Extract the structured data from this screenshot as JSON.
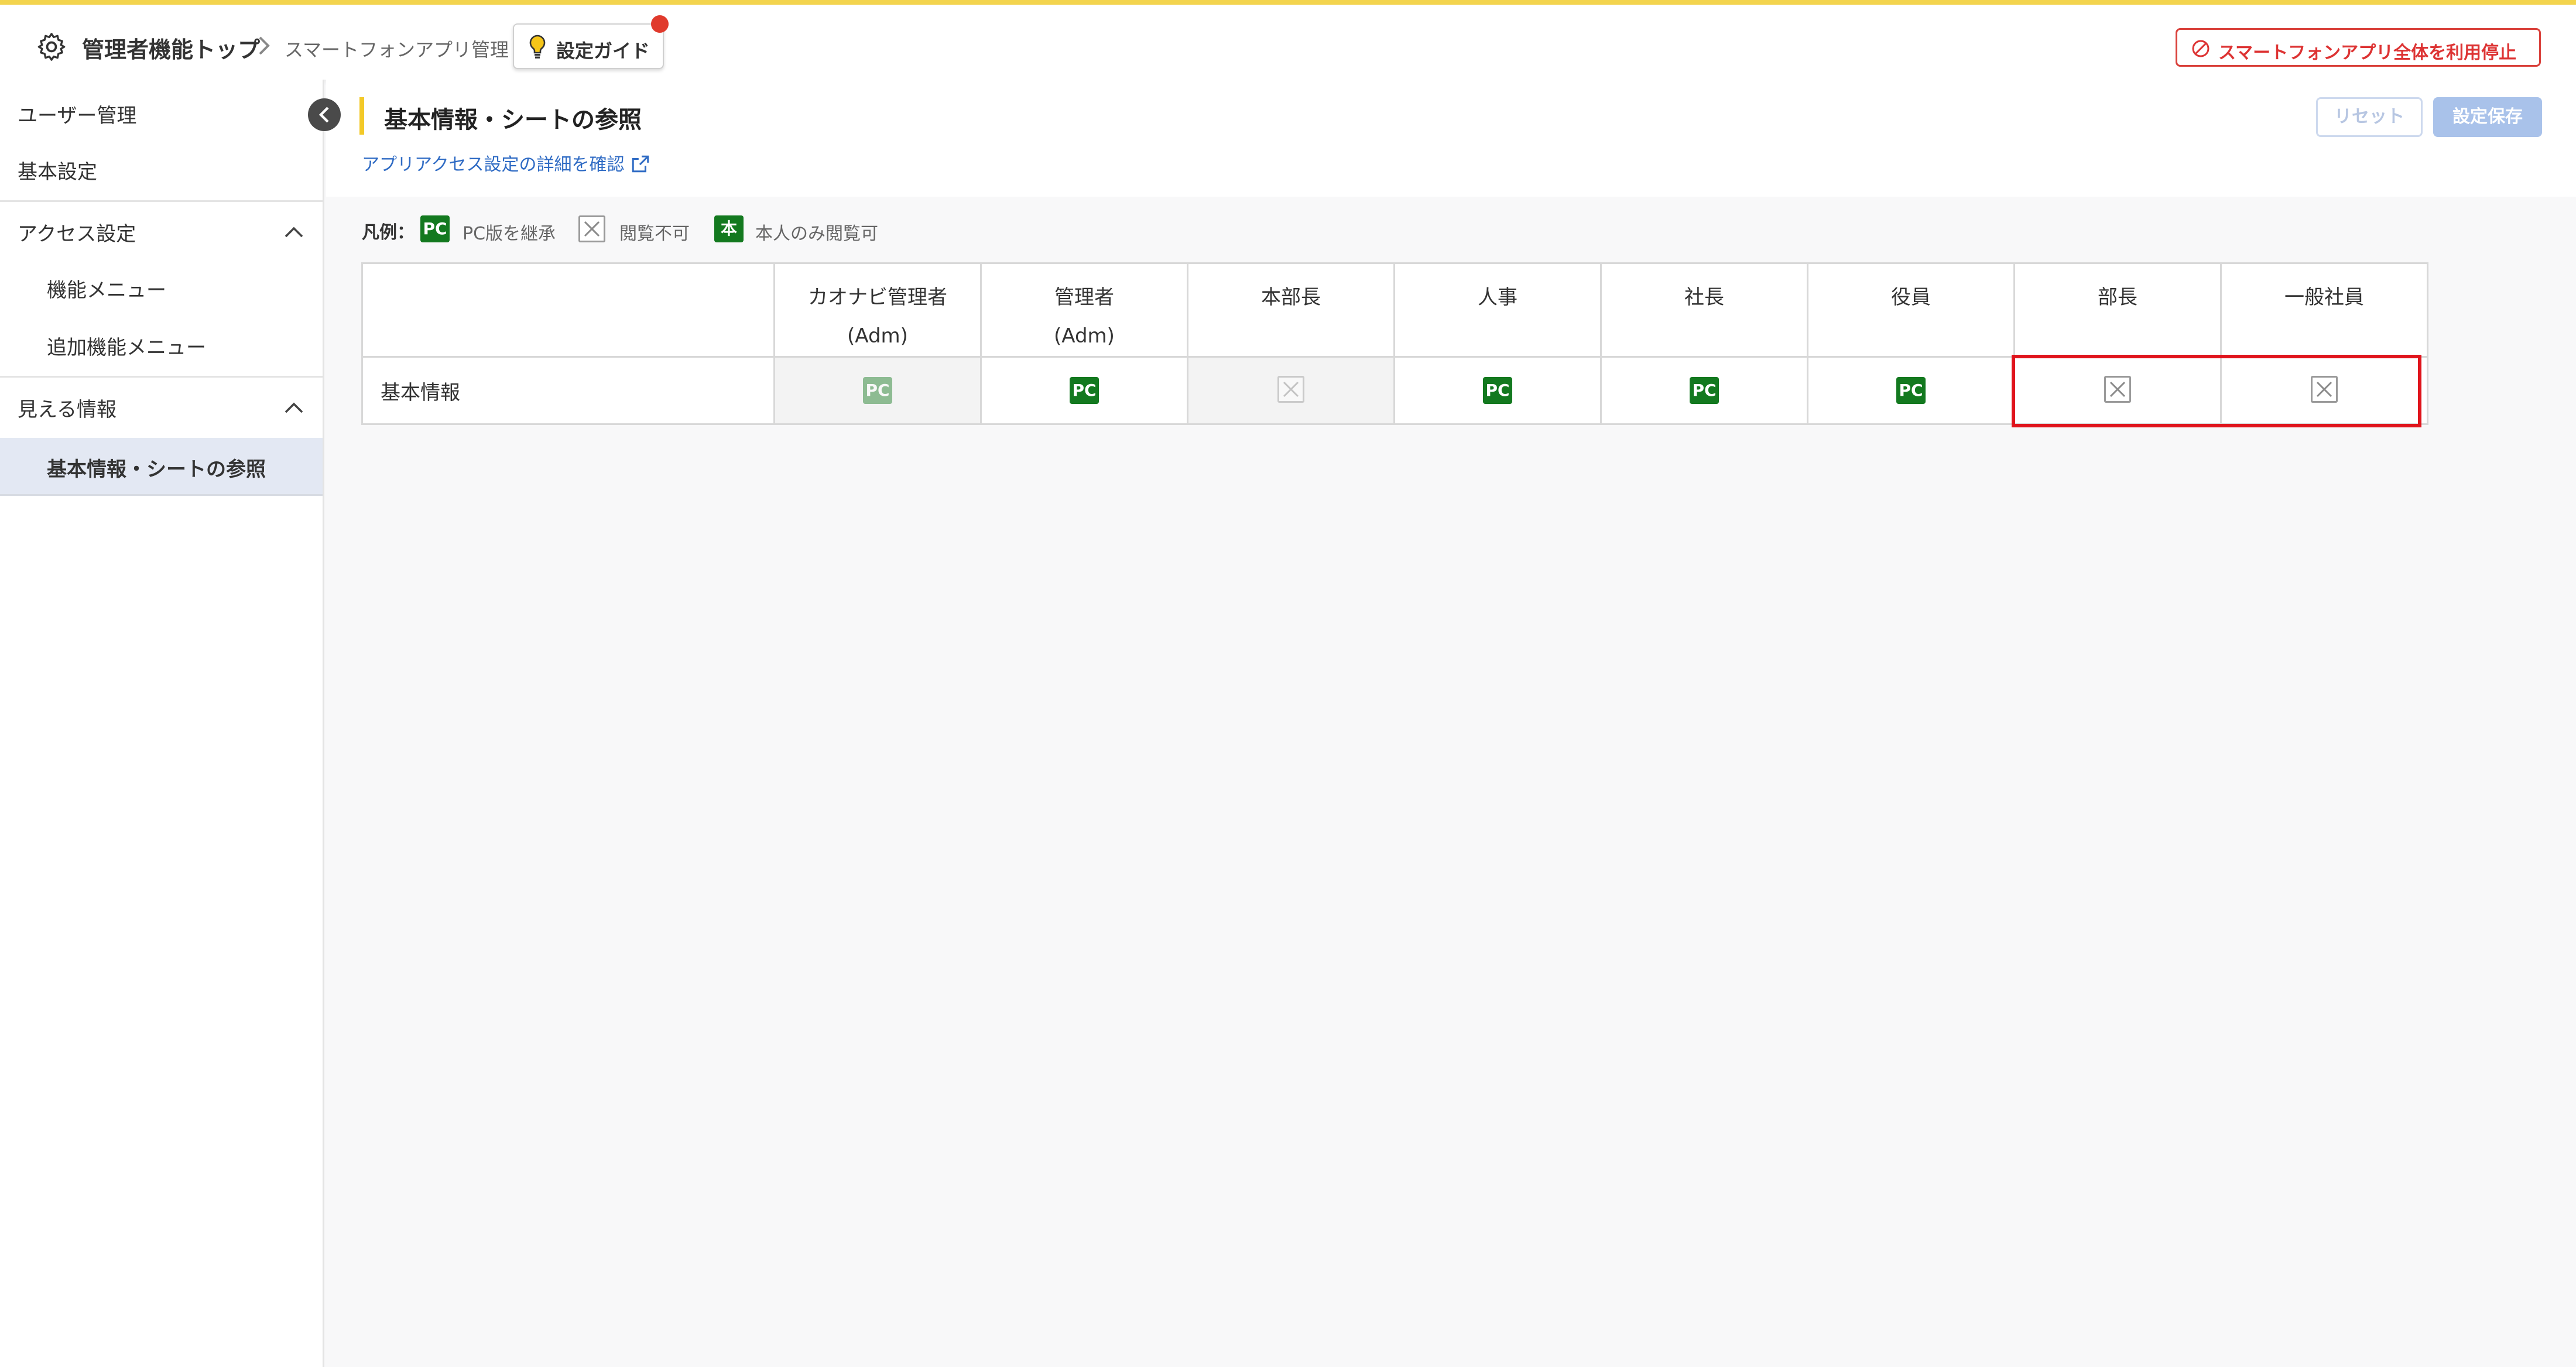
{
  "header": {
    "breadcrumb_home": "管理者機能トップ",
    "breadcrumb_current": "スマートフォンアプリ管理",
    "guide_button": "設定ガイド",
    "stop_button": "スマートフォンアプリ全体を利用停止"
  },
  "sidebar": {
    "user_mgmt": "ユーザー管理",
    "basic_settings": "基本設定",
    "access_settings": "アクセス設定",
    "function_menu": "機能メニュー",
    "additional_menu": "追加機能メニュー",
    "visible_info": "見える情報",
    "basic_info_sheet": "基本情報・シートの参照"
  },
  "main": {
    "title": "基本情報・シートの参照",
    "detail_link": "アプリアクセス設定の詳細を確認",
    "reset_button": "リセット",
    "save_button": "設定保存"
  },
  "legend": {
    "label": "凡例：",
    "pc_badge": "PC",
    "pc_text": "PC版を継承",
    "deny_text": "閲覧不可",
    "self_badge": "本",
    "self_text": "本人のみ閲覧可"
  },
  "table": {
    "columns": [
      {
        "line1": "カオナビ管理者",
        "line2": "(Adm)"
      },
      {
        "line1": "管理者",
        "line2": "(Adm)"
      },
      {
        "line1": "本部長",
        "line2": ""
      },
      {
        "line1": "人事",
        "line2": ""
      },
      {
        "line1": "社長",
        "line2": ""
      },
      {
        "line1": "役員",
        "line2": ""
      },
      {
        "line1": "部長",
        "line2": ""
      },
      {
        "line1": "一般社員",
        "line2": ""
      }
    ],
    "row_label": "基本情報",
    "cell_badge": "PC",
    "cells": [
      "pc-disabled",
      "pc",
      "deny-disabled",
      "pc",
      "pc",
      "pc",
      "deny",
      "deny"
    ]
  },
  "colors": {
    "accent_top": "#f3d44e",
    "badge_green": "#13791f",
    "highlight_red": "#e0141c",
    "link_blue": "#2f6bc4"
  }
}
